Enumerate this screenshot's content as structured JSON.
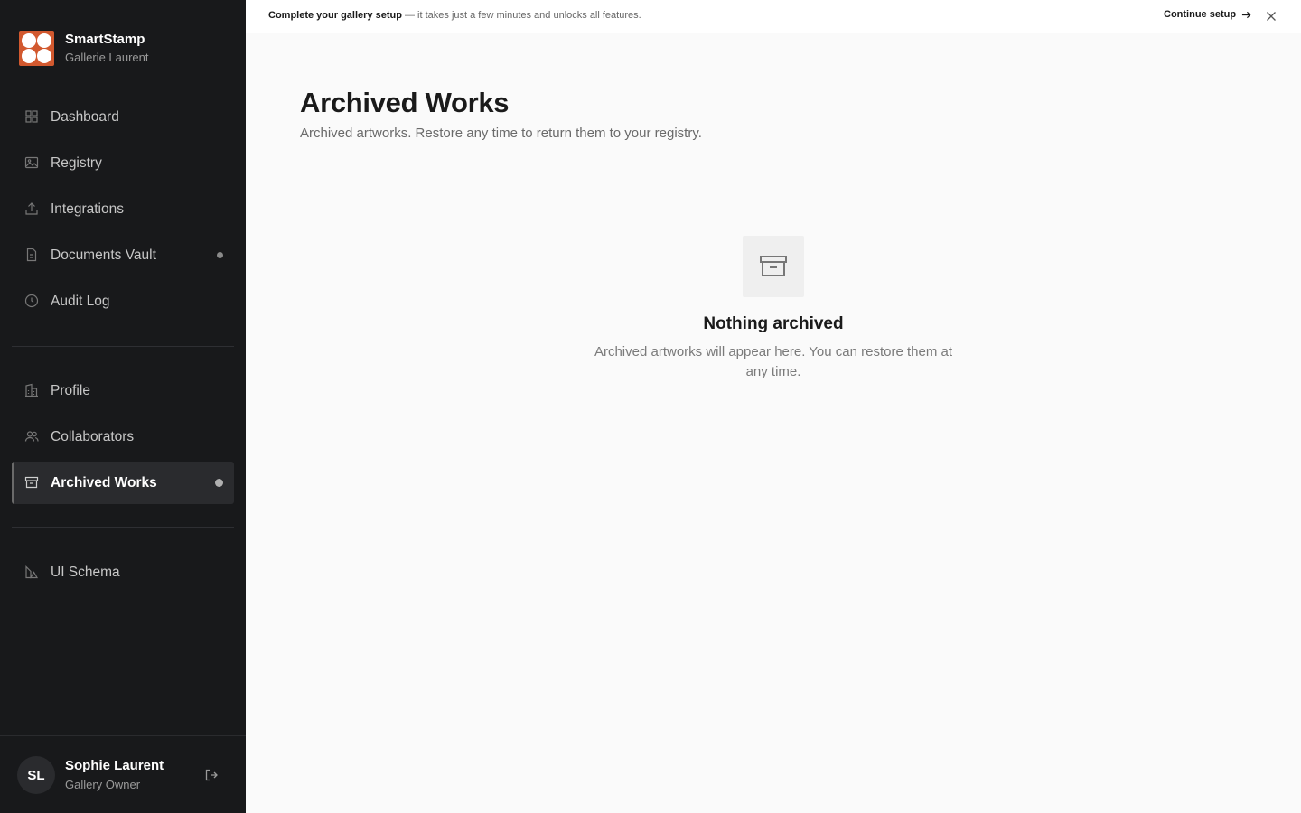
{
  "brand": {
    "name": "SmartStamp",
    "org": "Gallerie Laurent",
    "color": "#d2592f"
  },
  "banner": {
    "bold": "Complete your gallery setup",
    "text": "— it takes just a few minutes and unlocks all features.",
    "action": "Continue setup"
  },
  "nav": {
    "dashboard": "Dashboard",
    "registry": "Registry",
    "integrations": "Integrations",
    "documents": "Documents Vault",
    "audit": "Audit Log",
    "profile": "Profile",
    "collaborators": "Collaborators",
    "archived": "Archived Works",
    "schema": "UI Schema"
  },
  "user": {
    "initials": "SL",
    "name": "Sophie Laurent",
    "role": "Gallery Owner"
  },
  "page": {
    "title": "Archived Works",
    "subtitle": "Archived artworks. Restore any time to return them to your registry."
  },
  "empty": {
    "title": "Nothing archived",
    "text": "Archived artworks will appear here. You can restore them at any time."
  }
}
